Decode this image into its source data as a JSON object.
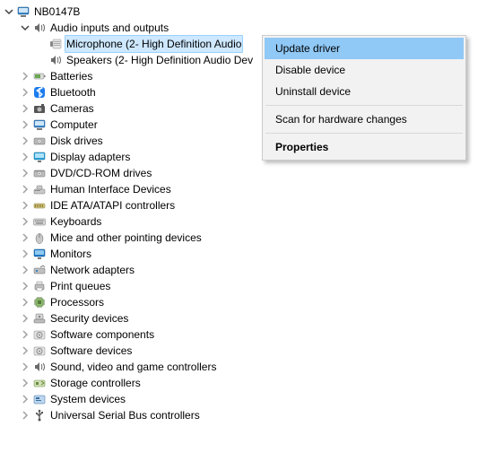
{
  "root": {
    "label": "NB0147B"
  },
  "expanded_category": {
    "label": "Audio inputs and outputs"
  },
  "audio_children": {
    "microphone": {
      "label": "Microphone (2- High Definition Audio"
    },
    "speakers": {
      "label": "Speakers (2- High Definition Audio Dev"
    }
  },
  "categories": [
    {
      "key": "batteries",
      "label": "Batteries"
    },
    {
      "key": "bluetooth",
      "label": "Bluetooth"
    },
    {
      "key": "cameras",
      "label": "Cameras"
    },
    {
      "key": "computer",
      "label": "Computer"
    },
    {
      "key": "disk",
      "label": "Disk drives"
    },
    {
      "key": "display",
      "label": "Display adapters"
    },
    {
      "key": "dvd",
      "label": "DVD/CD-ROM drives"
    },
    {
      "key": "hid",
      "label": "Human Interface Devices"
    },
    {
      "key": "ide",
      "label": "IDE ATA/ATAPI controllers"
    },
    {
      "key": "keyboards",
      "label": "Keyboards"
    },
    {
      "key": "mice",
      "label": "Mice and other pointing devices"
    },
    {
      "key": "monitors",
      "label": "Monitors"
    },
    {
      "key": "network",
      "label": "Network adapters"
    },
    {
      "key": "print",
      "label": "Print queues"
    },
    {
      "key": "processors",
      "label": "Processors"
    },
    {
      "key": "security",
      "label": "Security devices"
    },
    {
      "key": "softcomp",
      "label": "Software components"
    },
    {
      "key": "softdev",
      "label": "Software devices"
    },
    {
      "key": "sound",
      "label": "Sound, video and game controllers"
    },
    {
      "key": "storage",
      "label": "Storage controllers"
    },
    {
      "key": "system",
      "label": "System devices"
    },
    {
      "key": "usb",
      "label": "Universal Serial Bus controllers"
    }
  ],
  "menu": {
    "update": "Update driver",
    "disable": "Disable device",
    "uninstall": "Uninstall device",
    "scan": "Scan for hardware changes",
    "properties": "Properties"
  }
}
